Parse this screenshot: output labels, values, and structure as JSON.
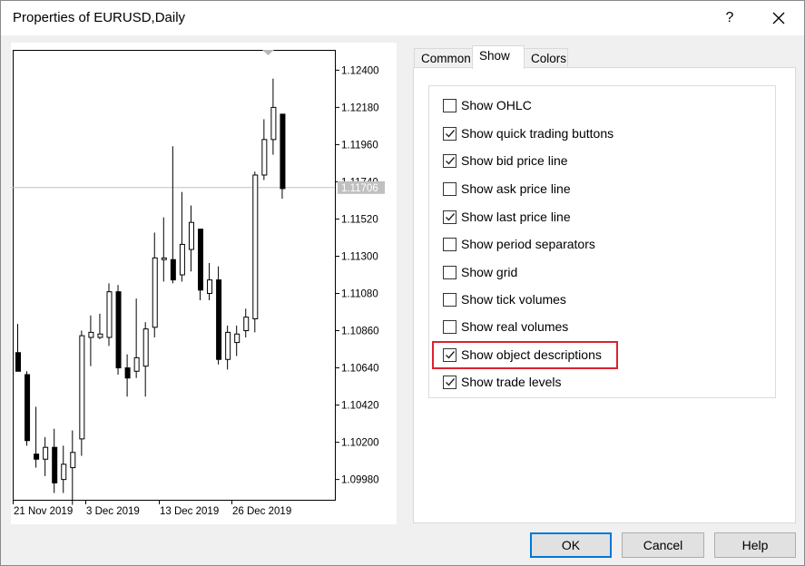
{
  "window": {
    "title": "Properties of EURUSD,Daily",
    "help_label": "?"
  },
  "tabs": [
    {
      "label": "Common",
      "active": false
    },
    {
      "label": "Show",
      "active": true
    },
    {
      "label": "Colors",
      "active": false
    }
  ],
  "options": [
    {
      "label": "Show OHLC",
      "checked": false
    },
    {
      "label": "Show quick trading buttons",
      "checked": true
    },
    {
      "label": "Show bid price line",
      "checked": true
    },
    {
      "label": "Show ask price line",
      "checked": false
    },
    {
      "label": "Show last price line",
      "checked": true
    },
    {
      "label": "Show period separators",
      "checked": false
    },
    {
      "label": "Show grid",
      "checked": false
    },
    {
      "label": "Show tick volumes",
      "checked": false
    },
    {
      "label": "Show real volumes",
      "checked": false
    },
    {
      "label": "Show object descriptions",
      "checked": true,
      "highlighted": true
    },
    {
      "label": "Show trade levels",
      "checked": true
    }
  ],
  "buttons": {
    "ok": "OK",
    "cancel": "Cancel",
    "help": "Help"
  },
  "colors": {
    "highlight": "#d9232f",
    "default_button_border": "#0078d7",
    "bid_line_label_bg": "#c0c0c0"
  },
  "chart_data": {
    "type": "candlestick",
    "y_ticks": [
      "1.12400",
      "1.12180",
      "1.11960",
      "1.11740",
      "1.11520",
      "1.11300",
      "1.11080",
      "1.10860",
      "1.10640",
      "1.10420",
      "1.10200",
      "1.09980"
    ],
    "ylim": [
      1.0986,
      1.1252
    ],
    "x_ticks": [
      "21 Nov 2019",
      "3 Dec 2019",
      "13 Dec 2019",
      "26 Dec 2019"
    ],
    "bid_price": "1.11706",
    "bid_value": 1.11706,
    "candles": [
      {
        "o": 1.1073,
        "h": 1.109,
        "l": 1.1062,
        "c": 1.1062
      },
      {
        "o": 1.106,
        "h": 1.1062,
        "l": 1.1018,
        "c": 1.1021
      },
      {
        "o": 1.1013,
        "h": 1.1041,
        "l": 1.1005,
        "c": 1.101
      },
      {
        "o": 1.101,
        "h": 1.1023,
        "l": 1.1,
        "c": 1.1017
      },
      {
        "o": 1.1017,
        "h": 1.1028,
        "l": 1.099,
        "c": 1.0996
      },
      {
        "o": 1.0998,
        "h": 1.1018,
        "l": 1.099,
        "c": 1.1007
      },
      {
        "o": 1.1005,
        "h": 1.1027,
        "l": 1.0983,
        "c": 1.1014
      },
      {
        "o": 1.1022,
        "h": 1.1086,
        "l": 1.1012,
        "c": 1.1083
      },
      {
        "o": 1.1082,
        "h": 1.1095,
        "l": 1.1065,
        "c": 1.1085
      },
      {
        "o": 1.1082,
        "h": 1.1096,
        "l": 1.1081,
        "c": 1.1084
      },
      {
        "o": 1.1082,
        "h": 1.1114,
        "l": 1.1077,
        "c": 1.1109
      },
      {
        "o": 1.1109,
        "h": 1.1113,
        "l": 1.106,
        "c": 1.1064
      },
      {
        "o": 1.1064,
        "h": 1.1072,
        "l": 1.1047,
        "c": 1.1058
      },
      {
        "o": 1.1062,
        "h": 1.1105,
        "l": 1.1058,
        "c": 1.107
      },
      {
        "o": 1.1065,
        "h": 1.1091,
        "l": 1.1047,
        "c": 1.1087
      },
      {
        "o": 1.1088,
        "h": 1.1144,
        "l": 1.1082,
        "c": 1.1129
      },
      {
        "o": 1.1128,
        "h": 1.1153,
        "l": 1.1115,
        "c": 1.1129
      },
      {
        "o": 1.1128,
        "h": 1.1195,
        "l": 1.1114,
        "c": 1.1116
      },
      {
        "o": 1.1119,
        "h": 1.1168,
        "l": 1.1115,
        "c": 1.1137
      },
      {
        "o": 1.1134,
        "h": 1.116,
        "l": 1.1121,
        "c": 1.115
      },
      {
        "o": 1.1146,
        "h": 1.1146,
        "l": 1.1104,
        "c": 1.111
      },
      {
        "o": 1.1108,
        "h": 1.1126,
        "l": 1.1104,
        "c": 1.1116
      },
      {
        "o": 1.1116,
        "h": 1.1124,
        "l": 1.1066,
        "c": 1.1069
      },
      {
        "o": 1.1069,
        "h": 1.1089,
        "l": 1.1063,
        "c": 1.1085
      },
      {
        "o": 1.1079,
        "h": 1.1089,
        "l": 1.1071,
        "c": 1.1084
      },
      {
        "o": 1.1086,
        "h": 1.1099,
        "l": 1.1082,
        "c": 1.1094
      },
      {
        "o": 1.1093,
        "h": 1.118,
        "l": 1.1085,
        "c": 1.1178
      },
      {
        "o": 1.1178,
        "h": 1.1211,
        "l": 1.1175,
        "c": 1.1199
      },
      {
        "o": 1.1199,
        "h": 1.1235,
        "l": 1.119,
        "c": 1.1218
      },
      {
        "o": 1.1214,
        "h": 1.1214,
        "l": 1.1164,
        "c": 1.117
      }
    ]
  }
}
